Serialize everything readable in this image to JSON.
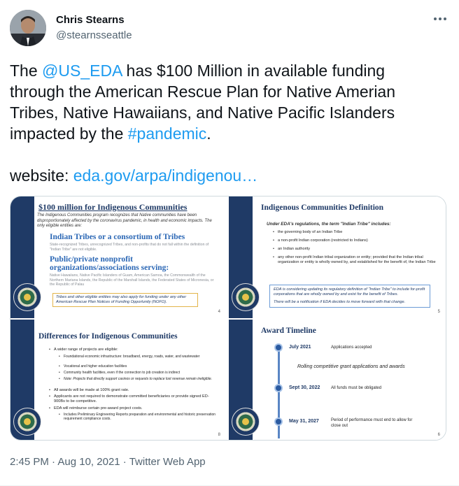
{
  "author": {
    "name": "Chris Stearns",
    "handle": "@stearnsseattle"
  },
  "tweet": {
    "line1_pre": "The ",
    "mention": "@US_EDA",
    "line1_post": " has $100 Million in available funding through the American Rescue Plan for Native Amerian Tribes, Native Hawaiians, and Native Pacific Islanders impacted by the ",
    "hashtag": "#pandemic",
    "line1_end": ".",
    "website_label": "website: ",
    "website_link": "eda.gov/arpa/indigenou…"
  },
  "slides": {
    "s1": {
      "title": "$100 million for Indigenous Communities",
      "intro": "The Indigenous Communities program recognizes that Native communities have been disproportionately affected by the coronavirus pandemic, in health and economic impacts. The only eligible entities are:",
      "sub1": "Indian Tribes or a consortium of Tribes",
      "sub1_note": "State-recognized Tribes, unrecognized Tribes, and non-profits that do not fall within the definition of \"Indian Tribe\" are not eligible.",
      "sub2": "Public/private nonprofit organizations/associations serving:",
      "sub2_note": "Native Hawaiians, Native Pacific Islanders of Guam, American Samoa, the Commonwealth of the Northern Mariana Islands, the Republic of the Marshall Islands, the Federated States of Micronesia, or the Republic of Palau",
      "box": "Tribes and other eligible entities may also apply for funding under any other American Rescue Plan Notices of Funding Opportunity (NOFO).",
      "page": "4"
    },
    "s2": {
      "title": "Indigenous Communities Definition",
      "intro": "Under EDA's regulations, the term \"Indian Tribe\" includes:",
      "bullets": [
        "the governing body of an Indian Tribe",
        "a non-profit Indian corporation (restricted to Indians)",
        "an Indian authority",
        "any other non-profit Indian tribal organization or entity; provided that the Indian tribal organization or entity is wholly owned by, and established for the benefit of, the Indian Tribe"
      ],
      "box_line1": "EDA is considering updating its regulatory definition of \"Indian Tribe\" to include for-profit corporations that are wholly owned by and exist for the benefit of Tribes.",
      "box_line2": "There will be a notification if EDA decides to move forward with that change.",
      "page": "5"
    },
    "s3": {
      "title": "Differences for Indigenous Communities",
      "bullets": [
        "A wider range of projects are eligible:",
        "Foundational economic infrastructure: broadband, energy, roads, water, and wastewater",
        "Vocational and higher education facilities",
        "Community health facilities, even if the connection to job creation is indirect",
        "Note: Projects that directly support casinos or requests to replace lost revenue remain ineligible.",
        "All awards will be made at 100% grant rate.",
        "Applicants are not required to demonstrate committed beneficiaries or provide signed ED-900Bs to be competitive.",
        "EDA will reimburse certain pre-award project costs.",
        "Includes Preliminary Engineering Reports preparation and environmental and historic preservation requirement compliance costs."
      ],
      "page": "8"
    },
    "s4": {
      "title": "Award Timeline",
      "events": [
        {
          "date": "July 2021",
          "desc": "Applications accepted"
        },
        {
          "date": "Sept 30, 2022",
          "desc": "All funds must be obligated"
        },
        {
          "date": "May 31, 2027",
          "desc": "Period of performance must end to allow for close out"
        }
      ],
      "rolling": "Rolling competitive grant applications and awards",
      "page": "6"
    }
  },
  "meta": {
    "time": "2:45 PM",
    "sep": " · ",
    "date": "Aug 10, 2021",
    "source": "Twitter Web App"
  }
}
